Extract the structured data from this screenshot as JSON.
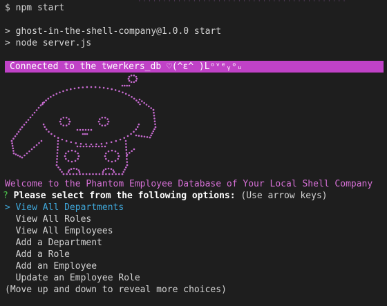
{
  "terminal": {
    "prompt_symbol": "$",
    "command": "npm start",
    "script_line_1": "> ghost-in-the-shell-company@1.0.0 start",
    "script_line_2": "> node server.js",
    "connection_banner": "Connected to the twerkers_db ♡(^ε^ )Lᵒᵛᵉᵧᵒᵤ"
  },
  "ascii_art": {
    "subject": "cinnamoroll-puppy",
    "color": "#c76bd0"
  },
  "welcome_message": "Welcome to the Phantom Employee Database of Your Local Shell Company",
  "question": {
    "mark": "?",
    "text": "Please select from the following options:",
    "hint": "(Use arrow keys)"
  },
  "menu": {
    "pointer": ">",
    "selected_index": 0,
    "options": [
      "View All Departments",
      "View All Roles",
      "View All Employees",
      "Add a Department",
      "Add a Role",
      "Add an Employee",
      "Update an Employee Role"
    ],
    "footer_hint": "(Move up and down to reveal more choices)"
  },
  "colors": {
    "background": "#1e1e1e",
    "text": "#d4d4d4",
    "banner_bg": "#c042c7",
    "welcome": "#d670d6",
    "question_mark": "#4ec94e",
    "selected": "#3fa6d8"
  }
}
